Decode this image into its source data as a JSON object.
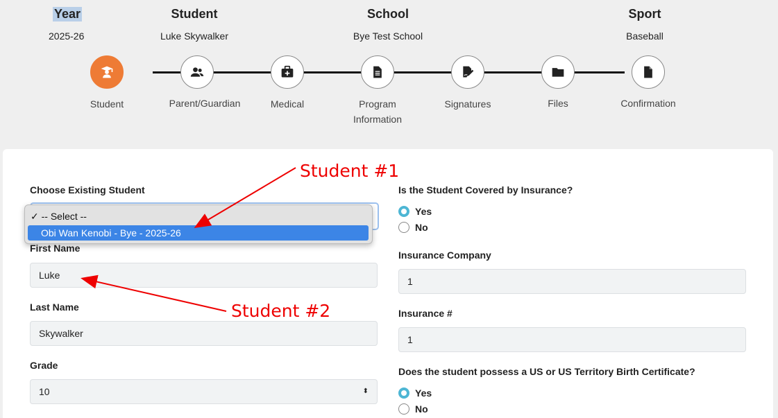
{
  "header": {
    "year_label": "Year",
    "year_value": "2025-26",
    "student_label": "Student",
    "student_value": "Luke Skywalker",
    "school_label": "School",
    "school_value": "Bye Test School",
    "sport_label": "Sport",
    "sport_value": "Baseball"
  },
  "steps": [
    {
      "label": "Student",
      "icon": "graduate-icon",
      "active": true
    },
    {
      "label": "Parent/Guardian",
      "icon": "users-icon"
    },
    {
      "label": "Medical",
      "icon": "medical-kit-icon"
    },
    {
      "label": "Program Information",
      "icon": "document-icon"
    },
    {
      "label": "Signatures",
      "icon": "signature-icon"
    },
    {
      "label": "Files",
      "icon": "folder-icon"
    },
    {
      "label": "Confirmation",
      "icon": "file-icon"
    }
  ],
  "accent_color": "#ee7b35",
  "form": {
    "choose_label": "Choose Existing Student",
    "options": [
      "✓ -- Select --",
      "Obi Wan Kenobi - Bye - 2025-26"
    ],
    "first_name_label": "First Name",
    "first_name": "Luke",
    "last_name_label": "Last Name",
    "last_name": "Skywalker",
    "grade_label": "Grade",
    "grade": "10",
    "insurance_q": "Is the Student Covered by Insurance?",
    "yes": "Yes",
    "no": "No",
    "insurance_company_label": "Insurance Company",
    "insurance_company": "1",
    "insurance_num_label": "Insurance #",
    "insurance_num": "1",
    "birth_cert_q": "Does the student possess a US or US Territory Birth Certificate?"
  },
  "annotations": {
    "a1": "Student #1",
    "a2": "Student #2"
  }
}
